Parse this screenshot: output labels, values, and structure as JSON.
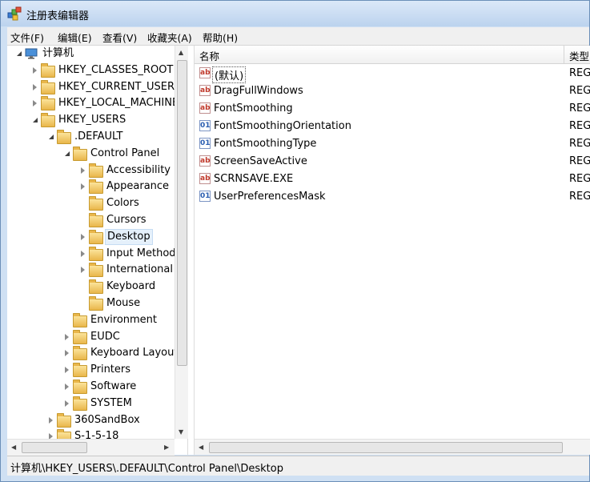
{
  "window": {
    "title": "注册表编辑器"
  },
  "menu": [
    "文件(F)",
    "编辑(E)",
    "查看(V)",
    "收藏夹(A)",
    "帮助(H)"
  ],
  "tree": [
    {
      "label": "计算机",
      "level": 0,
      "expander": "expanded",
      "icon": "computer-icon"
    },
    {
      "label": "HKEY_CLASSES_ROOT",
      "level": 1,
      "expander": "collapsed",
      "icon": "folder-icon"
    },
    {
      "label": "HKEY_CURRENT_USER",
      "level": 1,
      "expander": "collapsed",
      "icon": "folder-icon"
    },
    {
      "label": "HKEY_LOCAL_MACHINE",
      "level": 1,
      "expander": "collapsed",
      "icon": "folder-icon"
    },
    {
      "label": "HKEY_USERS",
      "level": 1,
      "expander": "expanded",
      "icon": "folder-icon"
    },
    {
      "label": ".DEFAULT",
      "level": 2,
      "expander": "expanded",
      "icon": "folder-icon"
    },
    {
      "label": "Control Panel",
      "level": 3,
      "expander": "expanded",
      "icon": "folder-icon"
    },
    {
      "label": "Accessibility",
      "level": 4,
      "expander": "collapsed",
      "icon": "folder-icon"
    },
    {
      "label": "Appearance",
      "level": 4,
      "expander": "collapsed",
      "icon": "folder-icon"
    },
    {
      "label": "Colors",
      "level": 4,
      "expander": "none",
      "icon": "folder-icon"
    },
    {
      "label": "Cursors",
      "level": 4,
      "expander": "none",
      "icon": "folder-icon"
    },
    {
      "label": "Desktop",
      "level": 4,
      "expander": "collapsed",
      "icon": "folder-icon",
      "selected": true
    },
    {
      "label": "Input Method",
      "level": 4,
      "expander": "collapsed",
      "icon": "folder-icon"
    },
    {
      "label": "International",
      "level": 4,
      "expander": "collapsed",
      "icon": "folder-icon"
    },
    {
      "label": "Keyboard",
      "level": 4,
      "expander": "none",
      "icon": "folder-icon"
    },
    {
      "label": "Mouse",
      "level": 4,
      "expander": "none",
      "icon": "folder-icon"
    },
    {
      "label": "Environment",
      "level": 3,
      "expander": "none",
      "icon": "folder-icon"
    },
    {
      "label": "EUDC",
      "level": 3,
      "expander": "collapsed",
      "icon": "folder-icon"
    },
    {
      "label": "Keyboard Layout",
      "level": 3,
      "expander": "collapsed",
      "icon": "folder-icon"
    },
    {
      "label": "Printers",
      "level": 3,
      "expander": "collapsed",
      "icon": "folder-icon"
    },
    {
      "label": "Software",
      "level": 3,
      "expander": "collapsed",
      "icon": "folder-icon"
    },
    {
      "label": "SYSTEM",
      "level": 3,
      "expander": "collapsed",
      "icon": "folder-icon"
    },
    {
      "label": "360SandBox",
      "level": 2,
      "expander": "collapsed",
      "icon": "folder-icon"
    },
    {
      "label": "S-1-5-18",
      "level": 2,
      "expander": "collapsed",
      "icon": "folder-icon"
    }
  ],
  "list": {
    "columns": {
      "name": "名称",
      "type": "类型"
    },
    "rows": [
      {
        "name": "(默认)",
        "type": "REG_",
        "icon": "string-value-icon",
        "default": true
      },
      {
        "name": "DragFullWindows",
        "type": "REG_",
        "icon": "string-value-icon"
      },
      {
        "name": "FontSmoothing",
        "type": "REG_",
        "icon": "string-value-icon"
      },
      {
        "name": "FontSmoothingOrientation",
        "type": "REG_",
        "icon": "binary-value-icon"
      },
      {
        "name": "FontSmoothingType",
        "type": "REG_",
        "icon": "binary-value-icon"
      },
      {
        "name": "ScreenSaveActive",
        "type": "REG_",
        "icon": "string-value-icon"
      },
      {
        "name": "SCRNSAVE.EXE",
        "type": "REG_",
        "icon": "string-value-icon"
      },
      {
        "name": "UserPreferencesMask",
        "type": "REG_",
        "icon": "binary-value-icon"
      }
    ]
  },
  "status": "计算机\\HKEY_USERS\\.DEFAULT\\Control Panel\\Desktop"
}
